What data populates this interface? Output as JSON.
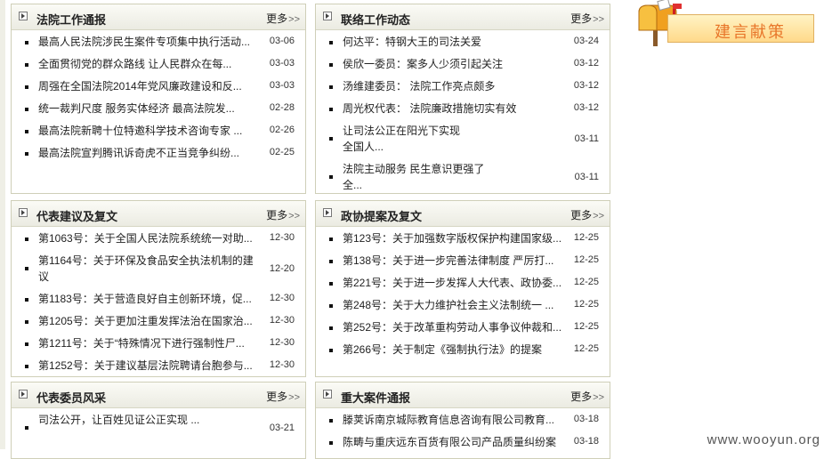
{
  "banner": {
    "label": "建言献策"
  },
  "watermark": "www.wooyun.org",
  "panels": {
    "court_work": {
      "title": "法院工作通报",
      "more": "更多",
      "items": [
        {
          "text": "最高人民法院涉民生案件专项集中执行活动...",
          "date": "03-06"
        },
        {
          "text": "全面贯彻党的群众路线 让人民群众在每...",
          "date": "03-03"
        },
        {
          "text": "周强在全国法院2014年党风廉政建设和反...",
          "date": "03-03"
        },
        {
          "text": "统一裁判尺度 服务实体经济 最高法院发...",
          "date": "02-28"
        },
        {
          "text": "最高法院新聘十位特邀科学技术咨询专家 ...",
          "date": "02-26"
        },
        {
          "text": "最高法院宣判腾讯诉奇虎不正当竞争纠纷...",
          "date": "02-25"
        }
      ]
    },
    "liaison": {
      "title": "联络工作动态",
      "more": "更多",
      "items": [
        {
          "text": "何达平：特钢大王的司法关爱",
          "date": "03-24"
        },
        {
          "text": "侯欣一委员：案多人少须引起关注",
          "date": "03-12"
        },
        {
          "text": "汤维建委员： 法院工作亮点颇多",
          "date": "03-12"
        },
        {
          "text": "周光权代表： 法院廉政措施切实有效",
          "date": "03-12"
        },
        {
          "text": "让司法公正在阳光下实现 全国人...",
          "date": "03-11"
        },
        {
          "text": "法院主动服务 民生意识更强了 全...",
          "date": "03-11"
        }
      ]
    },
    "rep_suggestions": {
      "title": "代表建议及复文",
      "more": "更多",
      "items": [
        {
          "text": "第1063号：关于全国人民法院系统统一对助...",
          "date": "12-30"
        },
        {
          "text": "第1164号：关于环保及食品安全执法机制的建议",
          "date": "12-20"
        },
        {
          "text": "第1183号：关于营造良好自主创新环境，促...",
          "date": "12-30"
        },
        {
          "text": "第1205号：关于更加注重发挥法治在国家治...",
          "date": "12-30"
        },
        {
          "text": "第1211号：关于“特殊情况下进行强制性尸...",
          "date": "12-30"
        },
        {
          "text": "第1252号：关于建议基层法院聘请台胞参与...",
          "date": "12-30"
        }
      ]
    },
    "cppcc_proposals": {
      "title": "政协提案及复文",
      "more": "更多",
      "items": [
        {
          "text": "第123号：关于加强数字版权保护构建国家级...",
          "date": "12-25"
        },
        {
          "text": "第138号：关于进一步完善法律制度 严厉打...",
          "date": "12-25"
        },
        {
          "text": "第221号：关于进一步发挥人大代表、政协委...",
          "date": "12-25"
        },
        {
          "text": "第248号：关于大力维护社会主义法制统一 ...",
          "date": "12-25"
        },
        {
          "text": "第252号：关于改革重构劳动人事争议仲裁和...",
          "date": "12-25"
        },
        {
          "text": "第266号：关于制定《强制执行法》的提案",
          "date": "12-25"
        }
      ]
    },
    "rep_profiles": {
      "title": "代表委员风采",
      "more": "更多",
      "items": [
        {
          "text": "司法公开，让百姓见证公正实现 ...",
          "date": "03-21"
        }
      ]
    },
    "major_cases": {
      "title": "重大案件通报",
      "more": "更多",
      "items": [
        {
          "text": "滕荚诉南京城际教育信息咨询有限公司教育...",
          "date": "03-18"
        },
        {
          "text": "陈畴与重庆远东百货有限公司产品质量纠纷案",
          "date": "03-18"
        }
      ]
    }
  }
}
